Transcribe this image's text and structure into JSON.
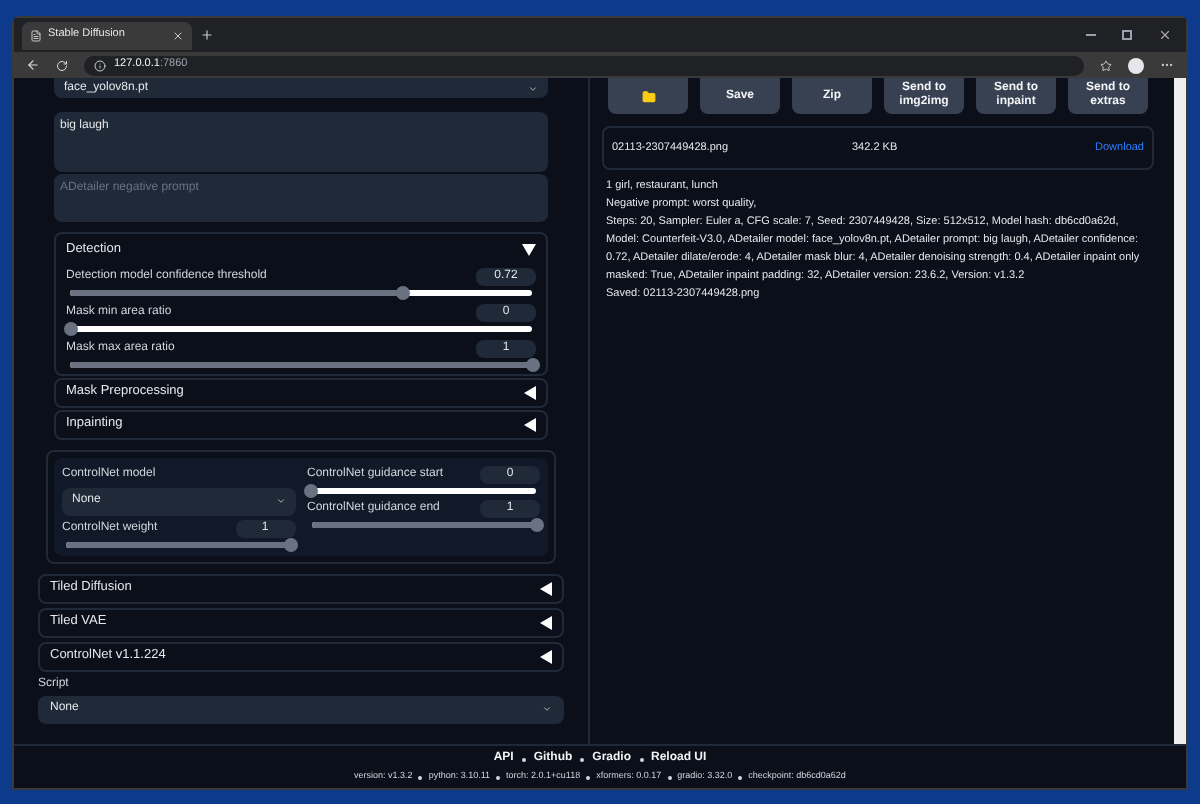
{
  "browser": {
    "tab_title": "Stable Diffusion",
    "address_host": "127.0.0.1",
    "address_port": ":7860"
  },
  "left": {
    "model_dropdown": "face_yolov8n.pt",
    "prompt": "big laugh",
    "negative_prompt": {
      "placeholder": "ADetailer negative prompt"
    },
    "detection": {
      "title": "Detection",
      "expanded": true,
      "sliders": [
        {
          "label": "Detection model confidence threshold",
          "value": "0.72",
          "level": 0.72
        },
        {
          "label": "Mask min area ratio",
          "value": "0",
          "level": 0
        },
        {
          "label": "Mask max area ratio",
          "value": "1",
          "level": 1
        }
      ]
    },
    "sections": [
      {
        "title": "Mask Preprocessing",
        "expanded": false
      },
      {
        "title": "Inpainting",
        "expanded": false
      }
    ],
    "controlnet": {
      "model_label": "ControlNet model",
      "model_value": "None",
      "weight": {
        "label": "ControlNet weight",
        "value": "1",
        "level": 1
      },
      "guidance": [
        {
          "label": "ControlNet guidance start",
          "value": "0",
          "level": 0
        },
        {
          "label": "ControlNet guidance end",
          "value": "1",
          "level": 1
        }
      ]
    },
    "accordions": [
      {
        "title": "Tiled Diffusion",
        "expanded": false
      },
      {
        "title": "Tiled VAE",
        "expanded": false
      },
      {
        "title": "ControlNet v1.1.224",
        "expanded": false
      }
    ],
    "script": {
      "label": "Script",
      "value": "None"
    }
  },
  "right": {
    "buttons": [
      {
        "kind": "icon"
      },
      {
        "kind": "text",
        "label": "Save"
      },
      {
        "kind": "text",
        "label": "Zip"
      },
      {
        "kind": "text",
        "label": "Send to img2img"
      },
      {
        "kind": "text",
        "label": "Send to inpaint"
      },
      {
        "kind": "text",
        "label": "Send to extras"
      }
    ],
    "file": {
      "name": "02113-2307449428.png",
      "size": "342.2 KB",
      "link": "Download"
    },
    "info": [
      "1 girl, restaurant, lunch",
      "Negative prompt: worst quality,",
      "Steps: 20, Sampler: Euler a, CFG scale: 7, Seed: 2307449428, Size: 512x512, Model hash: db6cd0a62d, Model: Counterfeit-V3.0, ADetailer model: face_yolov8n.pt, ADetailer prompt: big laugh, ADetailer confidence: 0.72, ADetailer dilate/erode: 4, ADetailer mask blur: 4, ADetailer denoising strength: 0.4, ADetailer inpaint only masked: True, ADetailer inpaint padding: 32, ADetailer version: 23.6.2, Version: v1.3.2",
      "Saved: 02113-2307449428.png"
    ]
  },
  "footer": {
    "links": [
      "API",
      "Github",
      "Gradio",
      "Reload UI"
    ],
    "versions": [
      "version: v1.3.2",
      "python: 3.10.11",
      "torch: 2.0.1+cu118",
      "xformers: 0.0.17",
      "gradio: 3.32.0",
      "checkpoint: db6cd0a62d"
    ]
  }
}
